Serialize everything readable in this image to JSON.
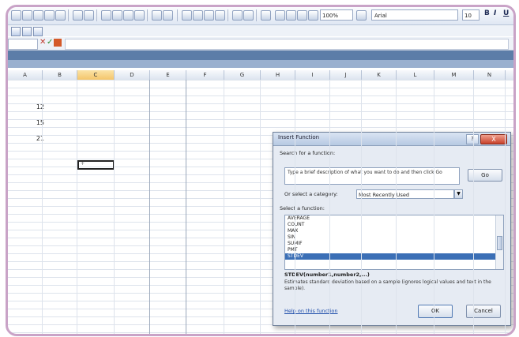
{
  "toolbar": {
    "zoom": "100%",
    "font": "Arial",
    "size": "10"
  },
  "columns": [
    {
      "label": "A",
      "w": 44
    },
    {
      "label": "B",
      "w": 44
    },
    {
      "label": "C",
      "w": 47,
      "selected": true
    },
    {
      "label": "D",
      "w": 45
    },
    {
      "label": "E",
      "w": 46
    },
    {
      "label": "F",
      "w": 48
    },
    {
      "label": "G",
      "w": 46
    },
    {
      "label": "H",
      "w": 44
    },
    {
      "label": "I",
      "w": 44
    },
    {
      "label": "J",
      "w": 40
    },
    {
      "label": "K",
      "w": 44
    },
    {
      "label": "L",
      "w": 48
    },
    {
      "label": "M",
      "w": 50
    },
    {
      "label": "N",
      "w": 40
    }
  ],
  "cells": [
    "12",
    "",
    "15",
    "",
    "21"
  ],
  "dialog": {
    "title": "Insert Function",
    "help": "?",
    "close": "X",
    "search_label": "Search for a function:",
    "search_text": "Type a brief description of what you want to do and then click Go",
    "go": "Go",
    "category_label": "Or select a category:",
    "category_value": "Most Recently Used",
    "select_label": "Select a function:",
    "functions": [
      "AVERAGE",
      "COUNT",
      "MAX",
      "SIN",
      "SUMIF",
      "PMT",
      "STDEV"
    ],
    "selected_index": 6,
    "signature": "STDEV(number1,number2,...)",
    "description": "Estimates standard deviation based on a sample (ignores logical values and text in the sample).",
    "help_link": "Help on this function",
    "ok": "OK",
    "cancel": "Cancel"
  }
}
